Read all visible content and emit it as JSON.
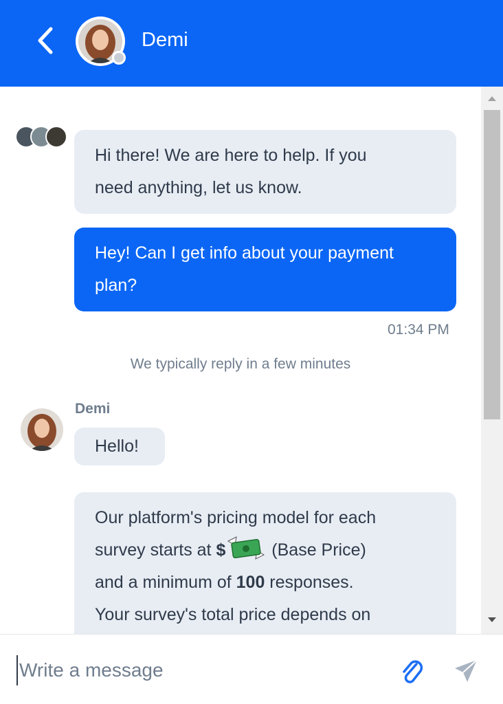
{
  "header": {
    "contact_name": "Demi",
    "back_icon": "chevron-left-icon",
    "status_color": "#c9ced6",
    "brand_color": "#0b66f5"
  },
  "messages": {
    "welcome": [
      "Hi there! We are here to help. If you",
      "need anything, let us know."
    ],
    "user_question": [
      "Hey! Can I get info about your payment",
      "plan?"
    ],
    "timestamp": "01:34 PM",
    "reply_note": "We typically reply in a few minutes",
    "agent_name": "Demi",
    "agent_hello": "Hello!",
    "pricing": {
      "line1": "Our platform's pricing model for each",
      "line2_prefix": "survey starts at ",
      "line2_bold": "$",
      "line2_suffix": " (Base Price)",
      "line3_prefix": "and a minimum of ",
      "line3_bold": "100",
      "line3_suffix": " responses.",
      "line4": "Your survey's total price depends on"
    }
  },
  "composer": {
    "placeholder": "Write a message",
    "attach_icon": "paperclip-icon",
    "send_icon": "send-icon"
  }
}
